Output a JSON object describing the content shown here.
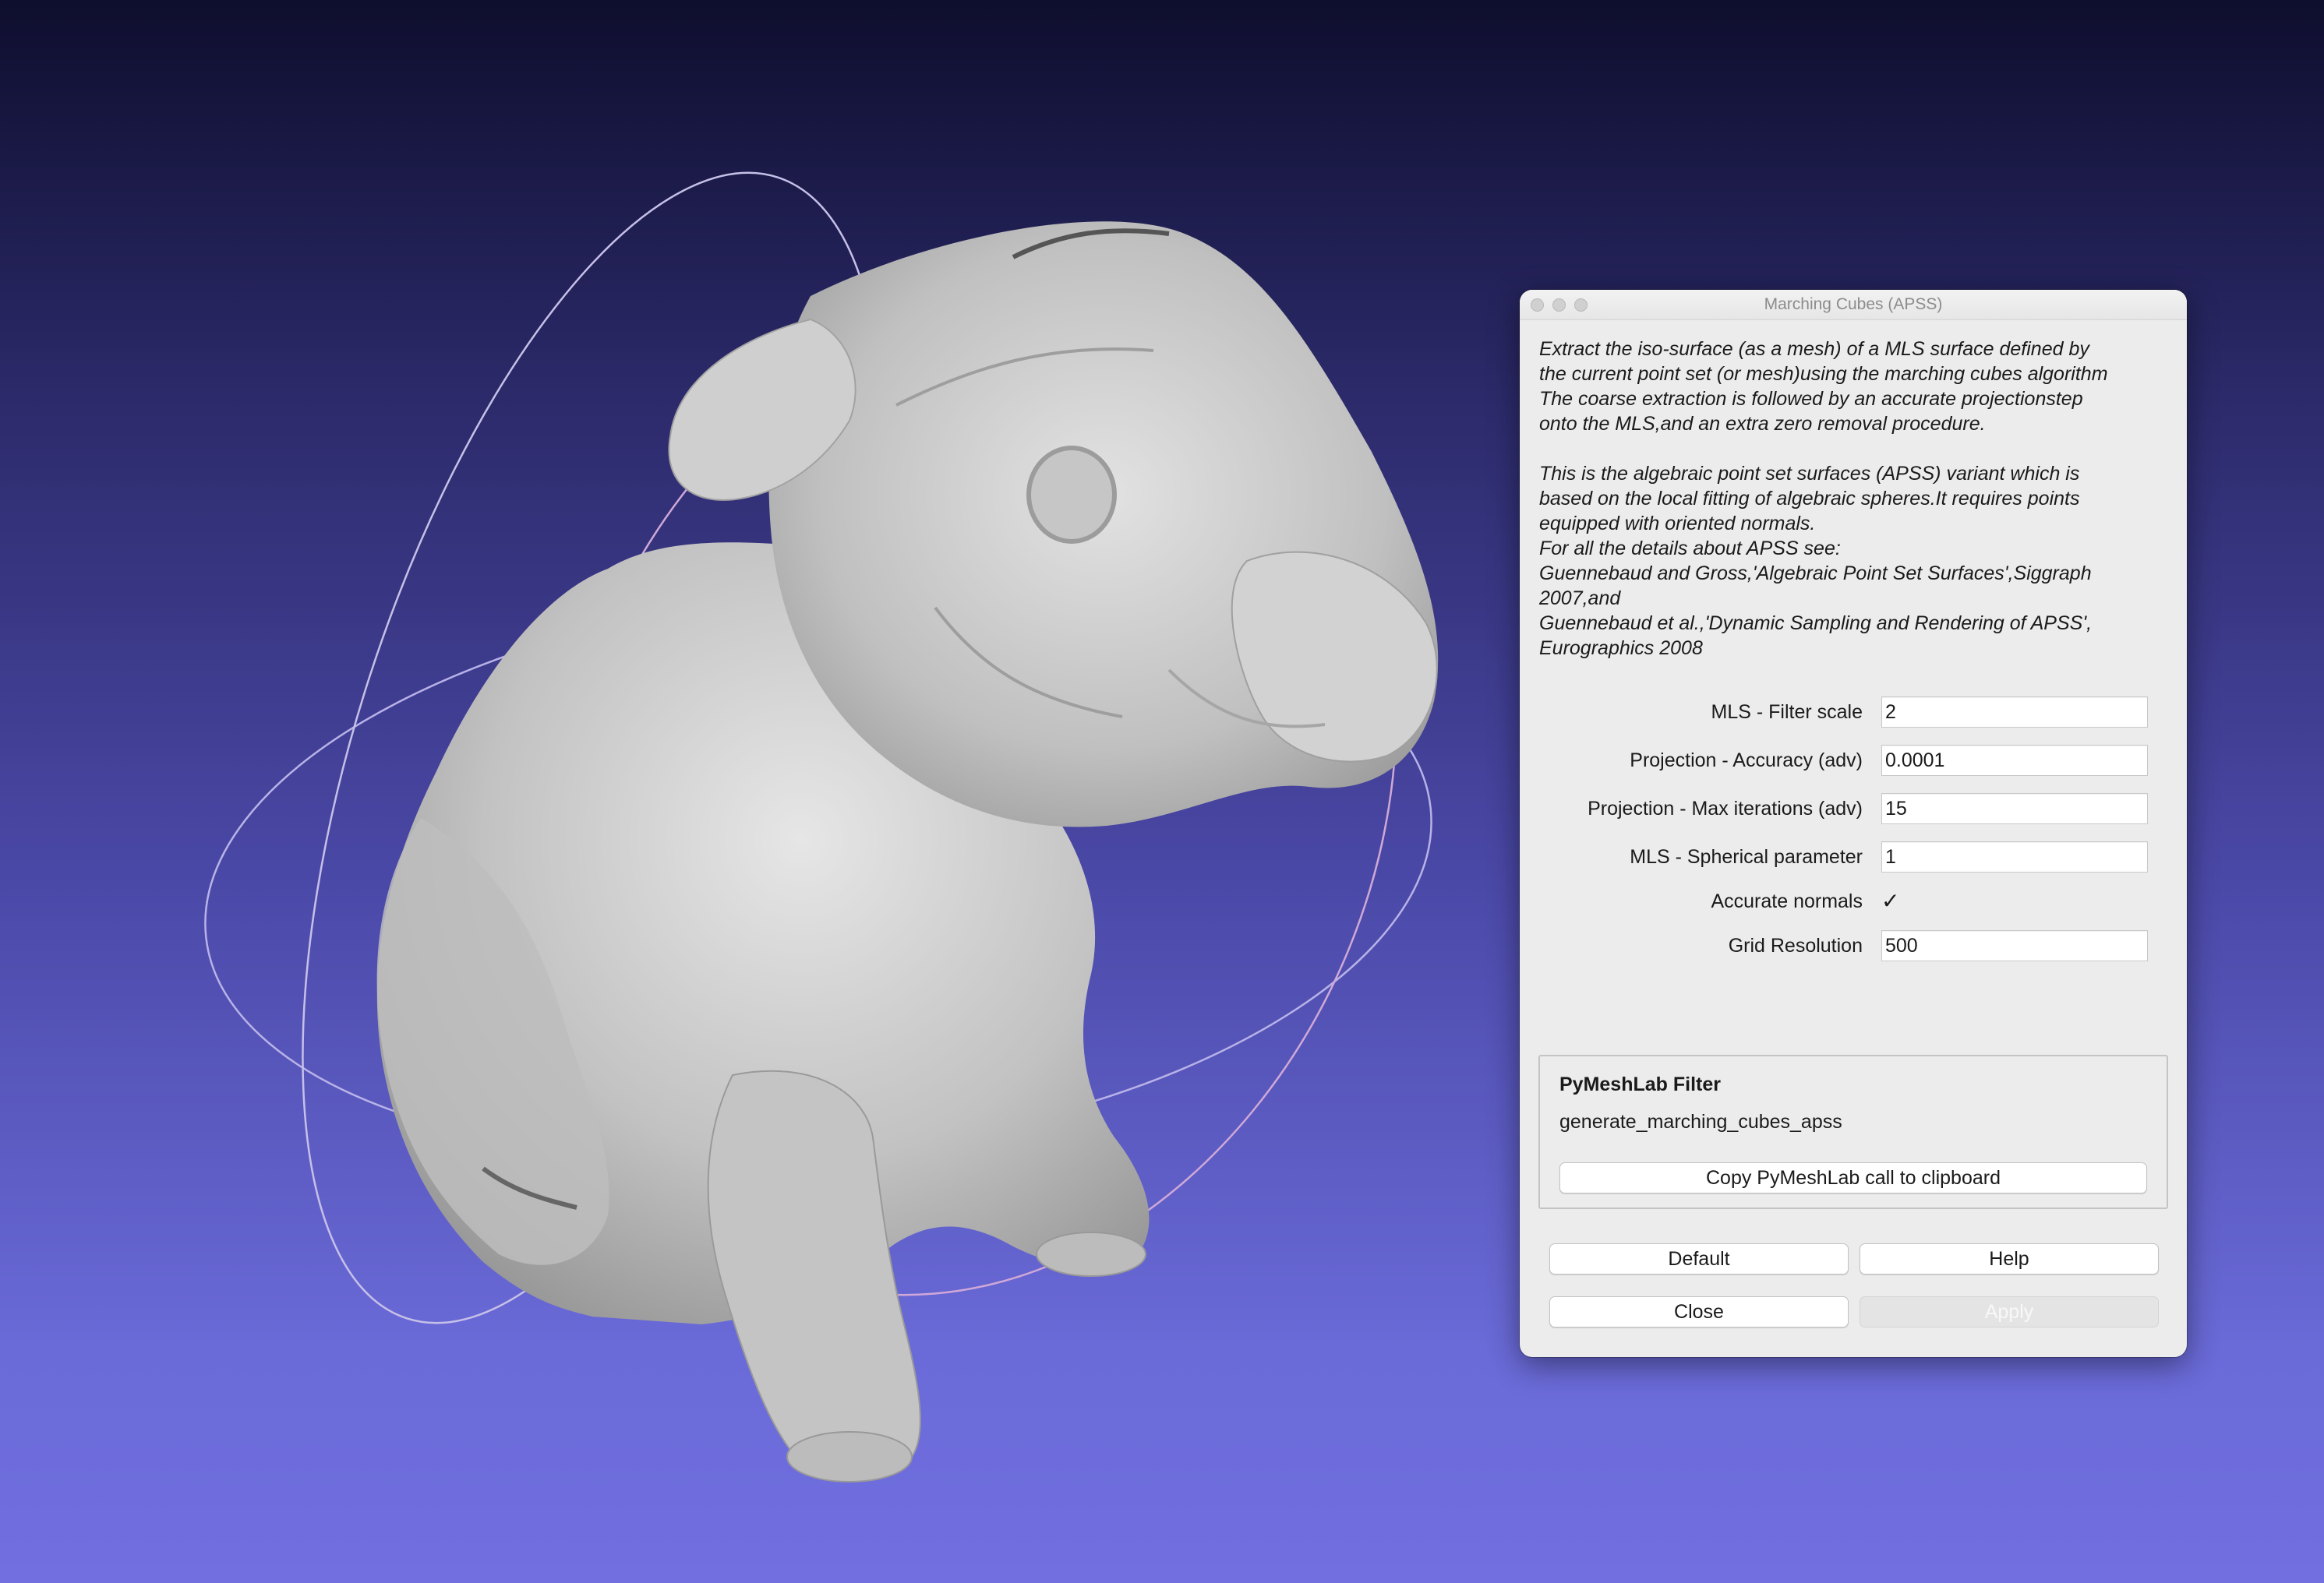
{
  "dialog": {
    "title": "Marching Cubes (APSS)",
    "description": [
      "Extract the iso-surface (as a mesh) of a MLS surface defined by\nthe current point set (or mesh)using the marching cubes algorithm\nThe coarse extraction is followed by an accurate projectionstep\nonto the MLS,and an extra zero removal procedure.",
      "This is the algebraic point set surfaces (APSS) variant which is\nbased on the local fitting of algebraic spheres.It requires points\nequipped with oriented normals.\nFor all the details about APSS see:\nGuennebaud and Gross,'Algebraic Point Set Surfaces',Siggraph\n2007,and\nGuennebaud et al.,'Dynamic Sampling and Rendering of APSS',\nEurographics 2008"
    ],
    "params": {
      "filter_scale": {
        "label": "MLS - Filter scale",
        "value": "2"
      },
      "projection_accuracy": {
        "label": "Projection - Accuracy (adv)",
        "value": "0.0001"
      },
      "max_iterations": {
        "label": "Projection - Max iterations (adv)",
        "value": "15"
      },
      "spherical_parameter": {
        "label": "MLS - Spherical parameter",
        "value": "1"
      },
      "accurate_normals": {
        "label": "Accurate normals",
        "checked": true,
        "mark": "✓"
      },
      "grid_resolution": {
        "label": "Grid Resolution",
        "value": "500"
      }
    },
    "pymeshlab": {
      "title": "PyMeshLab Filter",
      "call": "generate_marching_cubes_apss",
      "copy_label": "Copy PyMeshLab call to clipboard"
    },
    "buttons": {
      "default": "Default",
      "help": "Help",
      "close": "Close",
      "apply": "Apply"
    }
  },
  "colors": {
    "background_top": "#0e0e2e",
    "background_bottom": "#726fe0",
    "mesh": "#c8c8c8",
    "dialog_bg": "#ececec"
  }
}
